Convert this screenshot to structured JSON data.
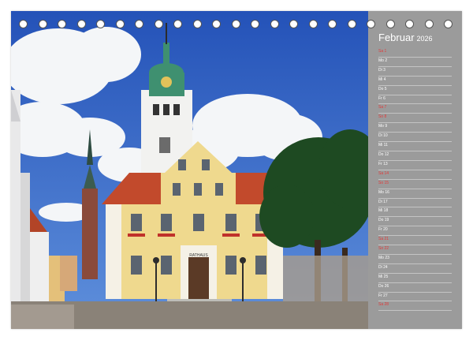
{
  "calendar": {
    "month": "Februar",
    "year": "2026",
    "days": [
      {
        "label": "Sa 1",
        "weekend": true
      },
      {
        "label": "Mo 2",
        "weekend": false
      },
      {
        "label": "Di 3",
        "weekend": false
      },
      {
        "label": "Mi 4",
        "weekend": false
      },
      {
        "label": "Do 5",
        "weekend": false
      },
      {
        "label": "Fr 6",
        "weekend": false
      },
      {
        "label": "Sa 7",
        "weekend": true
      },
      {
        "label": "So 8",
        "weekend": true
      },
      {
        "label": "Mo 9",
        "weekend": false
      },
      {
        "label": "Di 10",
        "weekend": false
      },
      {
        "label": "Mi 11",
        "weekend": false
      },
      {
        "label": "Do 12",
        "weekend": false
      },
      {
        "label": "Fr 13",
        "weekend": false
      },
      {
        "label": "Sa 14",
        "weekend": true
      },
      {
        "label": "So 15",
        "weekend": true
      },
      {
        "label": "Mo 16",
        "weekend": false
      },
      {
        "label": "Di 17",
        "weekend": false
      },
      {
        "label": "Mi 18",
        "weekend": false
      },
      {
        "label": "Do 19",
        "weekend": false
      },
      {
        "label": "Fr 20",
        "weekend": false
      },
      {
        "label": "Sa 21",
        "weekend": true
      },
      {
        "label": "So 22",
        "weekend": true
      },
      {
        "label": "Mo 23",
        "weekend": false
      },
      {
        "label": "Di 24",
        "weekend": false
      },
      {
        "label": "Mi 25",
        "weekend": false
      },
      {
        "label": "Do 26",
        "weekend": false
      },
      {
        "label": "Fr 27",
        "weekend": false
      },
      {
        "label": "Sa 28",
        "weekend": true
      }
    ]
  },
  "colors": {
    "sidebar": "#9b9b9b",
    "weekend": "#e23a3a",
    "weekday": "#ffffff",
    "sky": "#2f62c8",
    "facade": "#efd98e",
    "roof": "#c24a2c",
    "tower_copper": "#3f9070"
  },
  "photo": {
    "door_sign": "RATHAUS"
  }
}
